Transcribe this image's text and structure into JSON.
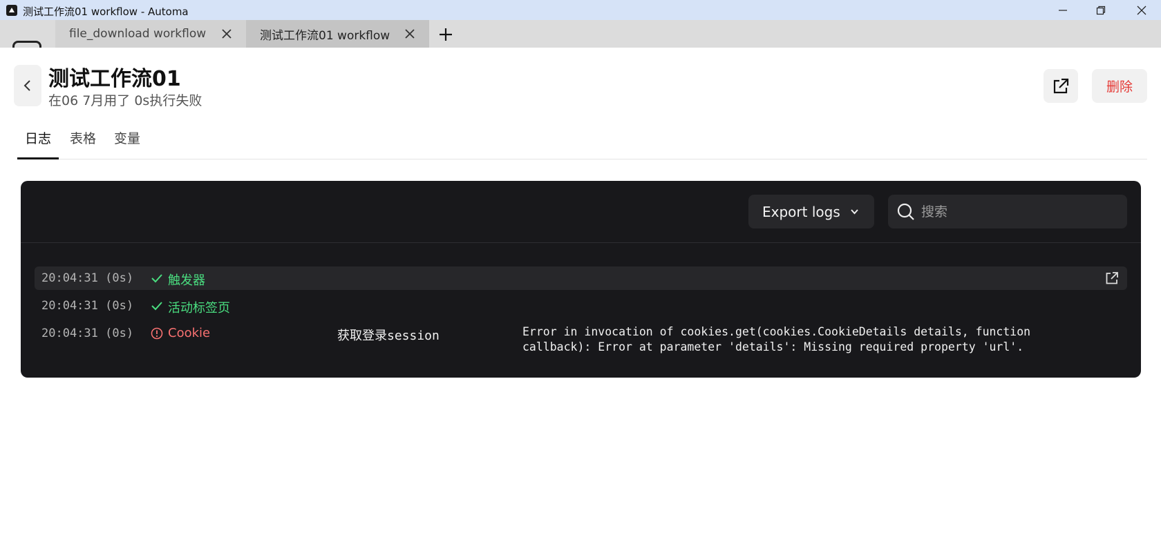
{
  "window": {
    "title": "测试工作流01 workflow - Automa"
  },
  "browser_tabs": [
    {
      "label": "file_download workflow",
      "active": false
    },
    {
      "label": "测试工作流01 workflow",
      "active": true
    }
  ],
  "header": {
    "title": "测试工作流01",
    "subtitle": "在06 7月用了 0s执行失败",
    "delete_label": "删除"
  },
  "page_tabs": [
    {
      "label": "日志",
      "active": true
    },
    {
      "label": "表格",
      "active": false
    },
    {
      "label": "变量",
      "active": false
    }
  ],
  "log_toolbar": {
    "export_label": "Export logs",
    "search_placeholder": "搜索"
  },
  "logs": [
    {
      "time": "20:04:31 (0s)",
      "status": "success",
      "name": "触发器",
      "description": "",
      "message": ""
    },
    {
      "time": "20:04:31 (0s)",
      "status": "success",
      "name": "活动标签页",
      "description": "",
      "message": ""
    },
    {
      "time": "20:04:31 (0s)",
      "status": "error",
      "name": "Cookie",
      "description": "获取登录session",
      "message_line1": "Error in invocation of cookies.get(cookies.CookieDetails details, function",
      "message_line2": "callback): Error at parameter 'details': Missing required property 'url'."
    }
  ],
  "colors": {
    "success": "#4ade80",
    "error": "#f87171",
    "delete": "#e53935",
    "panel_bg": "#18181b"
  },
  "icons": [
    "app-icon",
    "minimize-icon",
    "maximize-icon",
    "close-icon",
    "tab-close-icon",
    "add-tab-icon",
    "back-chevron-icon",
    "open-external-icon",
    "chevron-down-icon",
    "search-icon",
    "check-icon",
    "error-circle-icon"
  ]
}
